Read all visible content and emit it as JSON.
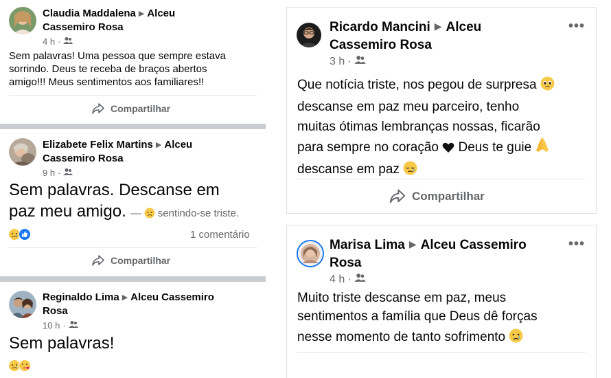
{
  "left_posts": [
    {
      "author": "Claudia Maddalena",
      "target_line1": "Alceu",
      "target_line2": "Cassemiro Rosa",
      "time": "4 h",
      "text_lines": [
        "Sem palavras! Uma pessoa que sempre estava",
        "sorrindo. Deus te receba de braços abertos",
        "amigo!!! Meus sentimentos aos familiares!!"
      ],
      "share_label": "Compartilhar"
    },
    {
      "author": "Elizabete Felix Martins",
      "target_line1": "Alceu",
      "target_line2": "Cassemiro Rosa",
      "time": "9 h",
      "text_line1": "Sem palavras.  Descanse em",
      "text_line2": "paz meu amigo.",
      "feeling": "sentindo-se triste.",
      "comments": "1 comentário",
      "share_label": "Compartilhar"
    },
    {
      "author": "Reginaldo Lima",
      "target_line1": "Alceu Cassemiro",
      "target_line2": "Rosa",
      "time": "10 h",
      "text": "Sem palavras!"
    }
  ],
  "right_posts": [
    {
      "author": "Ricardo Mancini",
      "target_line1": "Alceu",
      "target_line2": "Cassemiro Rosa",
      "time": "3 h",
      "text_line1": "Que notícia triste, nos pegou de surpresa",
      "text_line2": "descanse em paz meu parceiro, tenho",
      "text_line3": "muitas ótimas lembranças nossas, ficarão",
      "text_line4a": "para sempre no coração",
      "text_line4b": "Deus te guie",
      "text_line5": "descanse em paz",
      "share_label": "Compartilhar",
      "more_label": "•••"
    },
    {
      "author": "Marisa Lima",
      "target_line1": "Alceu Cassemiro",
      "target_line2": "Rosa",
      "time": "4 h",
      "text_line1": "Muito triste descanse em paz, meus",
      "text_line2": "sentimentos a família que Deus dê forças",
      "text_line3": "nesse momento de tanto sofrimento",
      "more_label": "•••"
    }
  ],
  "common": {
    "dot": "·",
    "arrow": "▶",
    "em_dash": "—"
  },
  "icons": {
    "audience": "friends-icon",
    "share": "share-arrow-icon",
    "more": "more-options-icon"
  }
}
